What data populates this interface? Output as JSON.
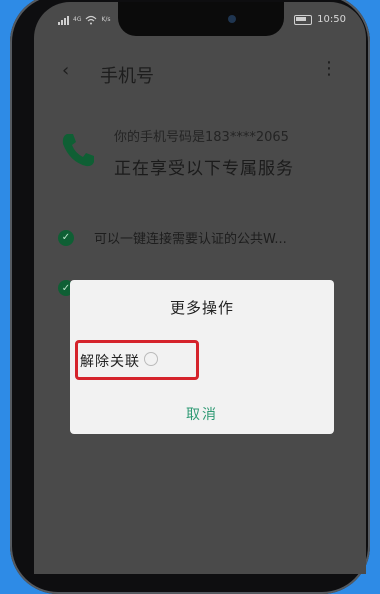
{
  "status": {
    "network": "4G",
    "speed": "K/s",
    "time": "10:50"
  },
  "header": {
    "title": "手机号"
  },
  "account": {
    "phone_line": "你的手机号码是183****2065",
    "service_line": "正在享受以下专属服务"
  },
  "services": [
    {
      "label": "可以一键连接需要认证的公共W..."
    }
  ],
  "dialog": {
    "title": "更多操作",
    "options": [
      {
        "label": "解除关联"
      }
    ],
    "cancel_label": "取消"
  },
  "colors": {
    "background": "#2e8be6",
    "screen_dimmed": "#4a4a4a",
    "accent_green": "#0f5f34",
    "cancel_text": "#2f9a74",
    "highlight_box": "#d5232b"
  },
  "icons": [
    "back-icon",
    "more-icon",
    "phone-icon",
    "check-icon",
    "wifi-icon",
    "signal-icon",
    "battery-icon"
  ]
}
